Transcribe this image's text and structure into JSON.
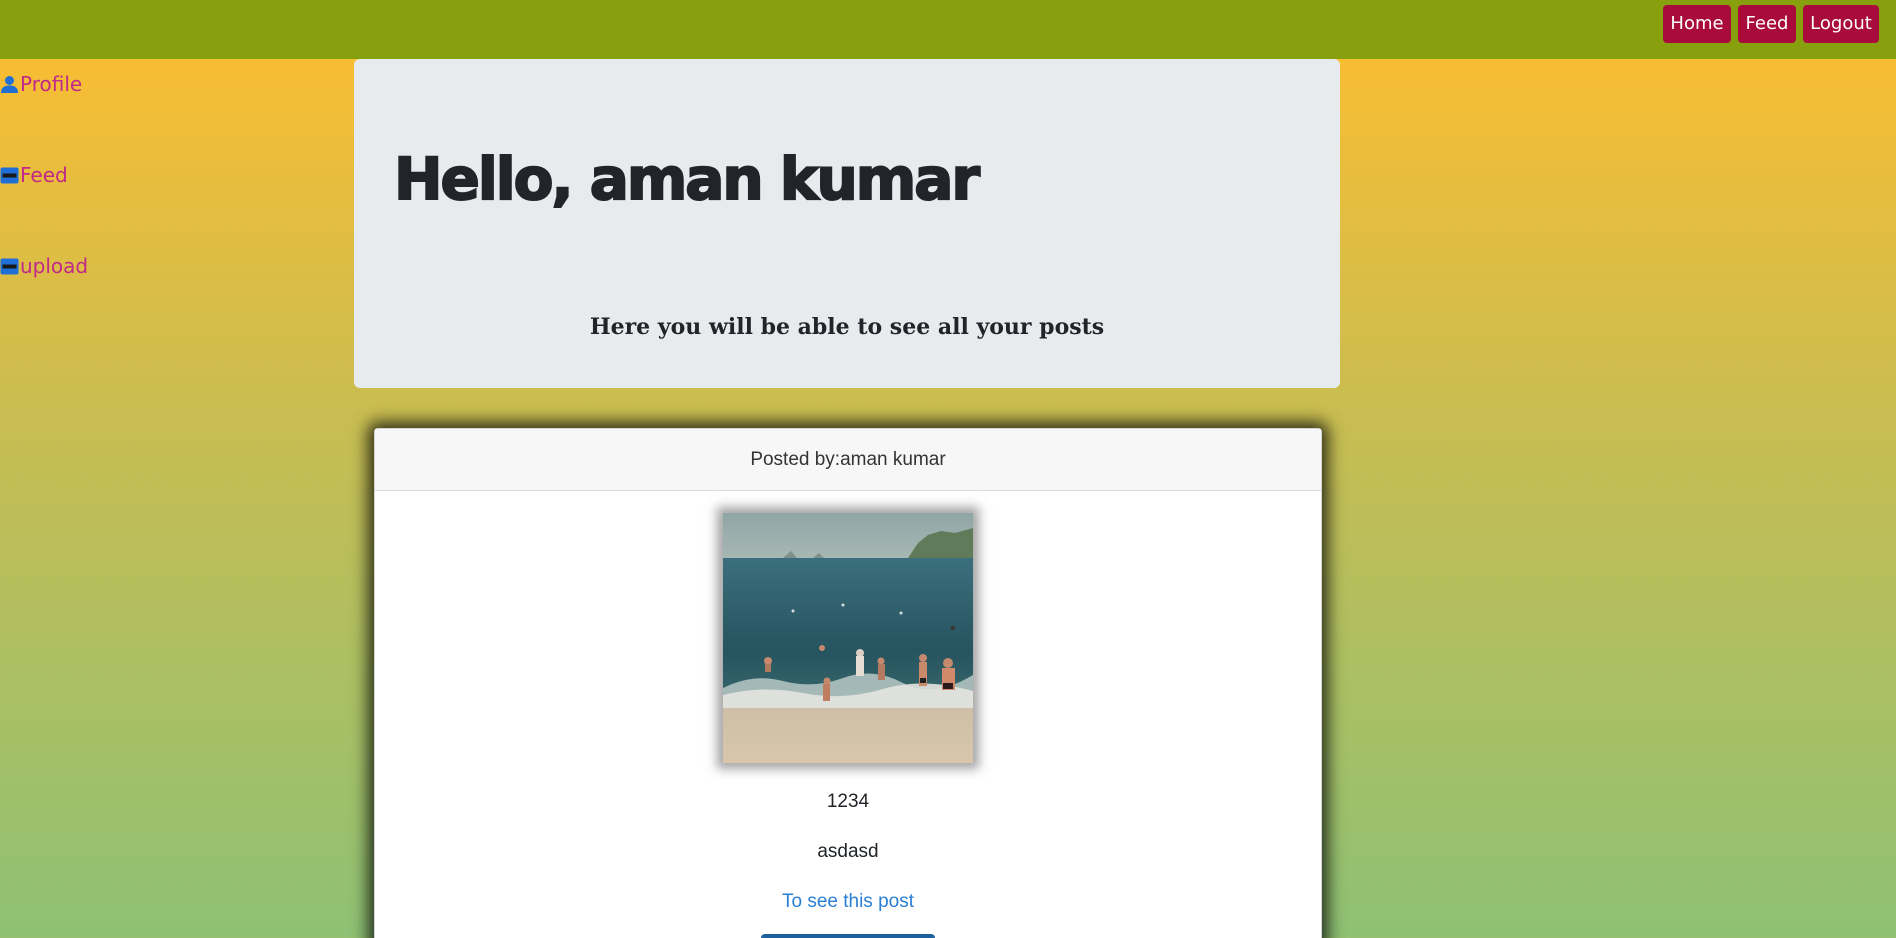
{
  "navbar": {
    "buttons": [
      {
        "label": "Home"
      },
      {
        "label": "Feed"
      },
      {
        "label": "Logout"
      }
    ],
    "background": "#88a00e",
    "button_color": "#a80b3c"
  },
  "sidebar": {
    "items": [
      {
        "label": "Profile",
        "icon": "user-icon"
      },
      {
        "label": "Feed",
        "icon": "card-icon"
      },
      {
        "label": "upload",
        "icon": "card-icon"
      }
    ],
    "link_color": "#c0288a",
    "icon_color": "#1f6fd6"
  },
  "jumbotron": {
    "greeting": "Hello, aman kumar",
    "subtitle": "Here you will be able to see all your posts"
  },
  "post": {
    "header": "Posted by:aman kumar",
    "image": "beach-photo",
    "title": "1234",
    "description": "asdasd",
    "link_label": "To see this post"
  }
}
